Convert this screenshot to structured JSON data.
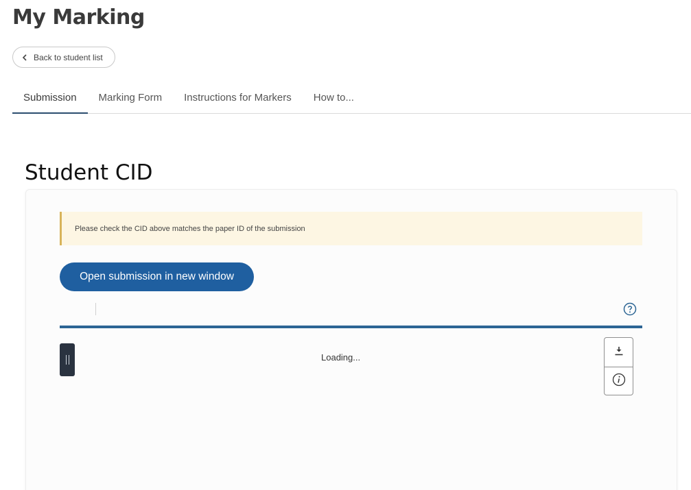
{
  "page": {
    "title": "My Marking"
  },
  "back": {
    "label": "Back to student list"
  },
  "tabs": [
    {
      "label": "Submission",
      "active": true
    },
    {
      "label": "Marking Form",
      "active": false
    },
    {
      "label": "Instructions for Markers",
      "active": false
    },
    {
      "label": "How to...",
      "active": false
    }
  ],
  "section": {
    "title": "Student CID"
  },
  "notice": {
    "text": "Please check the CID above matches the paper ID of the submission"
  },
  "actions": {
    "open_submission_label": "Open submission in new window"
  },
  "viewer": {
    "status": "Loading...",
    "help_icon": "help-circle-icon",
    "tools": [
      {
        "icon": "download-icon"
      },
      {
        "icon": "info-icon"
      }
    ]
  },
  "colors": {
    "primary": "#1f5fa0",
    "viewer_rule": "#2c6594",
    "notice_bg": "#fdf6e3",
    "notice_border": "#d8b35a",
    "tab_active": "#2a4d6e"
  }
}
